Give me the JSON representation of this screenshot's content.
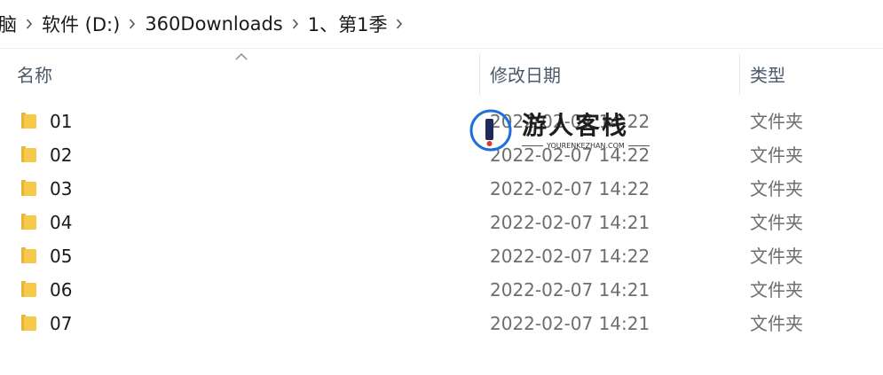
{
  "breadcrumb": {
    "items": [
      "脑",
      "软件 (D:)",
      "360Downloads",
      "1、第1季"
    ]
  },
  "columns": {
    "name": "名称",
    "date": "修改日期",
    "type": "类型"
  },
  "files": [
    {
      "name": "01",
      "date": "2022-02-07 14:22",
      "type": "文件夹"
    },
    {
      "name": "02",
      "date": "2022-02-07 14:22",
      "type": "文件夹"
    },
    {
      "name": "03",
      "date": "2022-02-07 14:22",
      "type": "文件夹"
    },
    {
      "name": "04",
      "date": "2022-02-07 14:21",
      "type": "文件夹"
    },
    {
      "name": "05",
      "date": "2022-02-07 14:22",
      "type": "文件夹"
    },
    {
      "name": "06",
      "date": "2022-02-07 14:21",
      "type": "文件夹"
    },
    {
      "name": "07",
      "date": "2022-02-07 14:21",
      "type": "文件夹"
    }
  ],
  "watermark": {
    "title": "游人客栈",
    "subtitle": "YOURENKEZHAN.COM"
  },
  "colors": {
    "folder": "#f7c948",
    "folder_dark": "#e9b43a",
    "header_text": "#4a5a6a",
    "secondary_text": "#6e6e6e",
    "watermark_blue": "#1e6fd9"
  }
}
